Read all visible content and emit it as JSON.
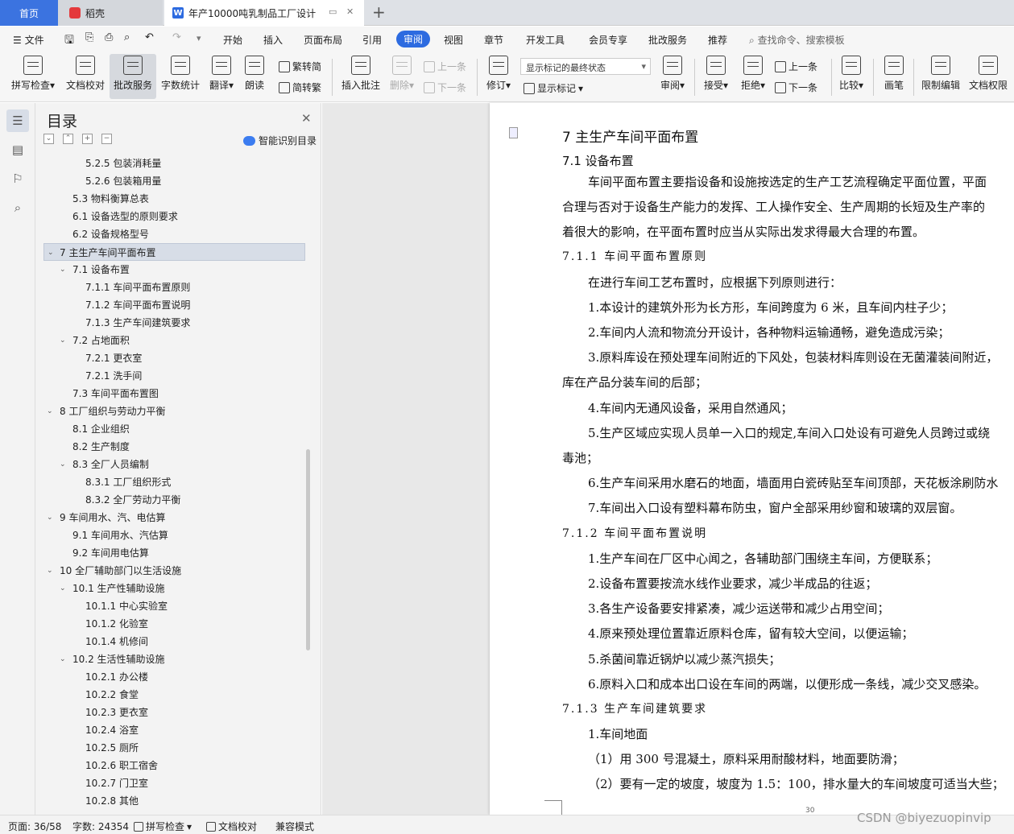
{
  "tabs": {
    "home": "首页",
    "daoke": "稻壳",
    "doc": "年产10000吨乳制品工厂设计"
  },
  "menu": {
    "file": "文件",
    "items": [
      "开始",
      "插入",
      "页面布局",
      "引用",
      "审阅",
      "视图",
      "章节",
      "开发工具",
      "会员专享",
      "批改服务",
      "推荐"
    ],
    "active": "审阅",
    "search_placeholder": "查找命令、搜索模板"
  },
  "toolbar": {
    "spell": "拼写检查",
    "proof": "文档校对",
    "correction": "批改服务",
    "wordcount": "字数统计",
    "translate": "翻译",
    "read": "朗读",
    "trad": "繁转简",
    "simp": "简转繁",
    "insert_comment": "插入批注",
    "delete": "删除",
    "prev": "上一条",
    "next": "下一条",
    "revise": "修订",
    "markup_select": "显示标记的最终状态",
    "show_markup": "显示标记",
    "review": "审阅",
    "accept": "接受",
    "reject": "拒绝",
    "prev2": "上一条",
    "next2": "下一条",
    "compare": "比较",
    "pen": "画笔",
    "restrict": "限制编辑",
    "permission": "文档权限"
  },
  "toc": {
    "title": "目录",
    "smart": "智能识别目录",
    "items": [
      {
        "label": "5.2.5 包装消耗量",
        "level": 3
      },
      {
        "label": "5.2.6 包装箱用量",
        "level": 3
      },
      {
        "label": "5.3 物料衡算总表",
        "level": 2
      },
      {
        "label": "6.1 设备选型的原则要求",
        "level": 2
      },
      {
        "label": "6.2 设备规格型号",
        "level": 2
      },
      {
        "label": "7 主生产车间平面布置",
        "level": 1,
        "arrow": true,
        "selected": true
      },
      {
        "label": "7.1 设备布置",
        "level": 2,
        "arrow": true
      },
      {
        "label": "7.1.1 车间平面布置原则",
        "level": 3
      },
      {
        "label": "7.1.2 车间平面布置说明",
        "level": 3
      },
      {
        "label": "7.1.3 生产车间建筑要求",
        "level": 3
      },
      {
        "label": "7.2 占地面积",
        "level": 2,
        "arrow": true
      },
      {
        "label": "7.2.1 更衣室",
        "level": 3
      },
      {
        "label": "7.2.1 洗手间",
        "level": 3
      },
      {
        "label": "7.3 车间平面布置图",
        "level": 2
      },
      {
        "label": "8 工厂组织与劳动力平衡",
        "level": 1,
        "arrow": true
      },
      {
        "label": "8.1 企业组织",
        "level": 2
      },
      {
        "label": "8.2 生产制度",
        "level": 2
      },
      {
        "label": "8.3 全厂人员编制",
        "level": 2,
        "arrow": true
      },
      {
        "label": "8.3.1 工厂组织形式",
        "level": 3
      },
      {
        "label": "8.3.2 全厂劳动力平衡",
        "level": 3
      },
      {
        "label": "9 车间用水、汽、电估算",
        "level": 1,
        "arrow": true
      },
      {
        "label": "9.1 车间用水、汽估算",
        "level": 2
      },
      {
        "label": "9.2 车间用电估算",
        "level": 2
      },
      {
        "label": "10 全厂辅助部门以生活设施",
        "level": 1,
        "arrow": true
      },
      {
        "label": "10.1 生产性辅助设施",
        "level": 2,
        "arrow": true
      },
      {
        "label": "10.1.1 中心实验室",
        "level": 3
      },
      {
        "label": "10.1.2 化验室",
        "level": 3
      },
      {
        "label": "10.1.4 机修间",
        "level": 3
      },
      {
        "label": "10.2 生活性辅助设施",
        "level": 2,
        "arrow": true
      },
      {
        "label": "10.2.1 办公楼",
        "level": 3
      },
      {
        "label": "10.2.2 食堂",
        "level": 3
      },
      {
        "label": "10.2.3 更衣室",
        "level": 3
      },
      {
        "label": "10.2.4 浴室",
        "level": 3
      },
      {
        "label": "10.2.5 厕所",
        "level": 3
      },
      {
        "label": "10.2.6 职工宿舍",
        "level": 3
      },
      {
        "label": "10.2.7 门卫室",
        "level": 3
      },
      {
        "label": "10.2.8 其他",
        "level": 3
      }
    ]
  },
  "doc": {
    "h1": "7  主生产车间平面布置",
    "h2": "7.1  设备布置",
    "p1a": "车间平面布置主要指设备和设施按选定的生产工艺流程确定平面位置，平面",
    "p1b": "合理与否对于设备生产能力的发挥、工人操作安全、生产周期的长短及生产率的",
    "p1c": "着很大的影响，在平面布置时应当从实际出发求得最大合理的布置。",
    "h3a": "7.1.1  车间平面布置原则",
    "p2": "在进行车间工艺布置时，应根据下列原则进行：",
    "r1": "1.本设计的建筑外形为长方形，车间跨度为 6 米，且车间内柱子少；",
    "r2": "2.车间内人流和物流分开设计，各种物料运输通畅，避免造成污染；",
    "r3a": "3.原料库设在预处理车间附近的下风处，包装材料库则设在无菌灌装间附近，",
    "r3b": "库在产品分装车间的后部；",
    "r4": "4.车间内无通风设备，采用自然通风；",
    "r5a": "5.生产区域应实现人员单一入口的规定,车间入口处设有可避免人员跨过或绕",
    "r5b": "毒池；",
    "r6": "6.生产车间采用水磨石的地面，墙面用白瓷砖贴至车间顶部，天花板涂刷防水",
    "r7": "7.车间出入口设有塑料幕布防虫，窗户全部采用纱窗和玻璃的双层窗。",
    "h3b": "7.1.2  车间平面布置说明",
    "s1": "1.生产车间在厂区中心闻之，各辅助部门围绕主车间，方便联系；",
    "s2": "2.设备布置要按流水线作业要求，减少半成品的往返；",
    "s3": "3.各生产设备要安排紧凑，减少运送带和减少占用空间；",
    "s4": "4.原来预处理位置靠近原料仓库，留有较大空间，以便运输；",
    "s5": "5.杀菌间靠近锅炉以减少蒸汽损失；",
    "s6": "6.原料入口和成本出口设在车间的两端，以便形成一条线，减少交叉感染。",
    "h3c": "7.1.3  生产车间建筑要求",
    "b1": "1.车间地面",
    "b2": "（1）用 300 号混凝土，原料采用耐酸材料，地面要防滑；",
    "b3": "（2）要有一定的坡度，坡度为 1.5：100，排水量大的车间坡度可适当大些；",
    "pagenum": "30"
  },
  "status": {
    "page": "页面: 36/58",
    "words": "字数: 24354",
    "spell": "拼写检查",
    "proof": "文档校对",
    "compat": "兼容模式"
  },
  "watermark": "CSDN @biyezuopinvip"
}
